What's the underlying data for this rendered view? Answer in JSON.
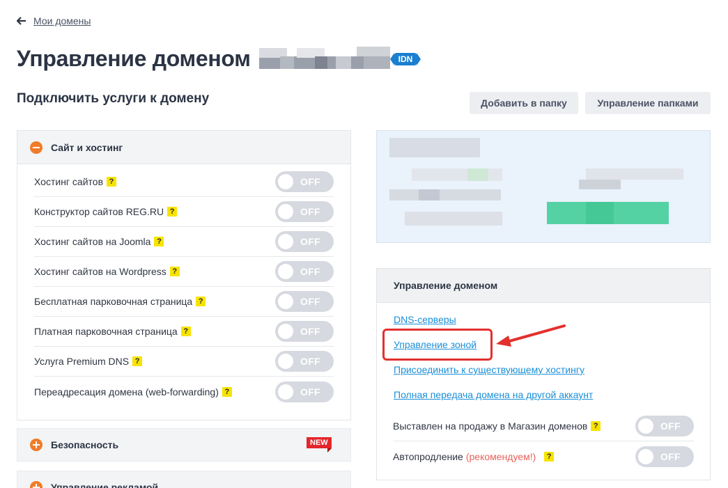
{
  "nav": {
    "back_label": "Мои домены"
  },
  "header": {
    "title": "Управление доменом",
    "badge": "IDN"
  },
  "subtitle": "Подключить услуги к домену",
  "toolbar": {
    "add_to_folder": "Добавить в папку",
    "manage_folders": "Управление папками"
  },
  "services": {
    "section_title": "Сайт и хостинг",
    "rows": [
      {
        "label": "Хостинг сайтов",
        "help": "?",
        "state": "OFF"
      },
      {
        "label": "Конструктор сайтов REG.RU",
        "help": "?",
        "state": "OFF"
      },
      {
        "label": "Хостинг сайтов на Joomla",
        "help": "?",
        "state": "OFF"
      },
      {
        "label": "Хостинг сайтов на Wordpress",
        "help": "?",
        "state": "OFF"
      },
      {
        "label": "Бесплатная парковочная страница",
        "help": "?",
        "state": "OFF"
      },
      {
        "label": "Платная парковочная страница",
        "help": "?",
        "state": "OFF"
      },
      {
        "label": "Услуга Premium DNS",
        "help": "?",
        "state": "OFF"
      },
      {
        "label": "Переадресация домена (web-forwarding)",
        "help": "?",
        "state": "OFF"
      }
    ],
    "security_title": "Безопасность",
    "security_badge": "NEW",
    "ads_title": "Управление рекламой"
  },
  "domain_management": {
    "title": "Управление доменом",
    "links": {
      "dns": "DNS-серверы",
      "zone": "Управление зоной",
      "attach": "Присоединить к существующему хостингу",
      "transfer": "Полная передача домена на другой аккаунт"
    },
    "for_sale": {
      "label": "Выставлен на продажу в Магазин доменов",
      "help": "?",
      "state": "OFF"
    },
    "autorenew": {
      "label": "Автопродление",
      "note": "(рекомендуем!)",
      "help": "?",
      "state": "OFF"
    }
  },
  "colors": {
    "accent_orange": "#f07c2a",
    "link_blue": "#1a8fd8",
    "highlight_red": "#e3302d",
    "badge_blue": "#1a7fd1"
  }
}
